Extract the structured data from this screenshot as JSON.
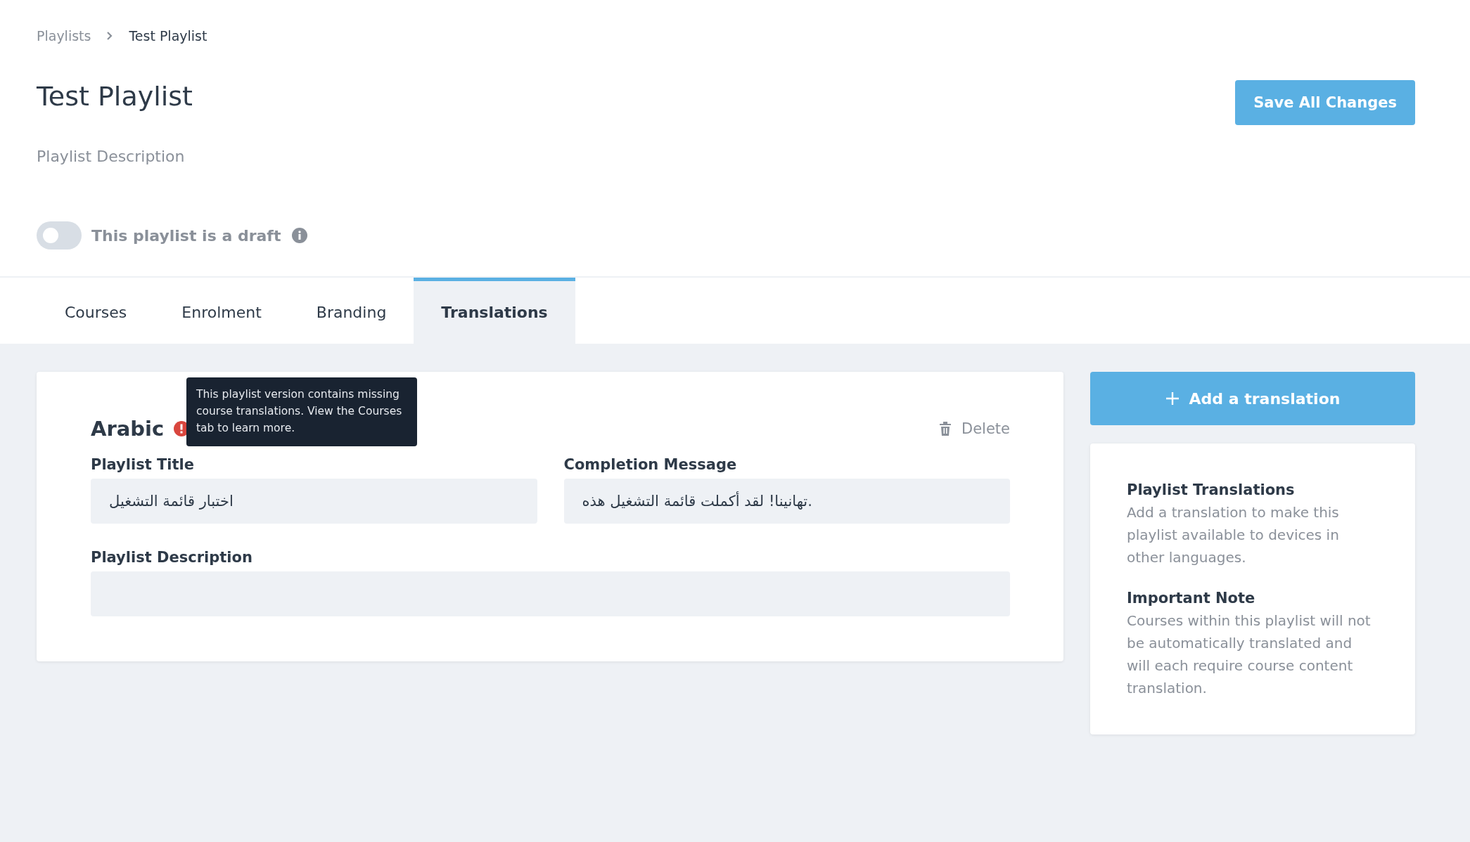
{
  "breadcrumb": [
    {
      "label": "Playlists",
      "current": false
    },
    {
      "label": "Test Playlist",
      "current": true
    }
  ],
  "header": {
    "title": "Test Playlist",
    "description_placeholder": "Playlist Description",
    "save_button": "Save All Changes"
  },
  "draft_toggle": {
    "label": "This playlist is a draft",
    "on": false
  },
  "tabs": [
    {
      "label": "Courses",
      "selected": false
    },
    {
      "label": "Enrolment",
      "selected": false
    },
    {
      "label": "Branding",
      "selected": false
    },
    {
      "label": "Translations",
      "selected": true
    }
  ],
  "translation": {
    "language": "Arabic",
    "warning": true,
    "tooltip": "This playlist version contains missing course translations. View the Courses tab to learn more.",
    "delete": "Delete",
    "title_field": {
      "label": "Playlist Title",
      "value": "اختبار قائمة التشغيل"
    },
    "message_field": {
      "label": "Completion Message",
      "value": "تهانينا! لقد أكملت قائمة التشغيل هذه."
    },
    "description_field": {
      "label": "Playlist Description"
    }
  },
  "add_button": "Add a translation",
  "info": [
    {
      "title": "Playlist Translations",
      "text": "Add a translation to make this playlist available to devices in other languages."
    },
    {
      "title": "Important Note",
      "text": "Courses within this playlist will not be automatically translated and will each require course content translation."
    }
  ]
}
